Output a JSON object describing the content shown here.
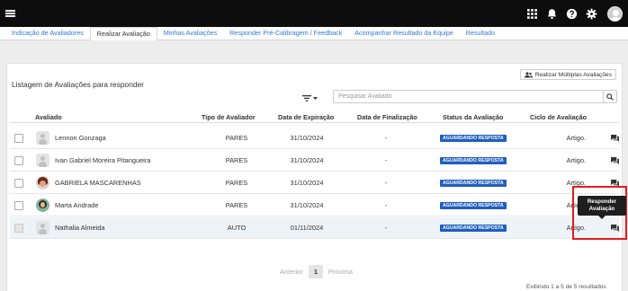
{
  "tabs": [
    {
      "label": "Indicação de Avaliadores"
    },
    {
      "label": "Realizar Avaliação"
    },
    {
      "label": "Minhas Avaliações"
    },
    {
      "label": "Responder Pré-Calibragem / Feedback"
    },
    {
      "label": "Acompanhar Resultado da Equipe"
    },
    {
      "label": "Resultado"
    }
  ],
  "panel": {
    "title": "Listagem de Avaliações para responder",
    "multi_button": "Realizar Múltiplas Avaliações",
    "search_placeholder": "Pesquisar Avaliado"
  },
  "columns": {
    "avaliado": "Avaliado",
    "tipo": "Tipo de Avaliador",
    "expiracao": "Data de Expiração",
    "finalizacao": "Data de Finalização",
    "status": "Status da Avaliação",
    "ciclo": "Ciclo de Avaliação"
  },
  "rows": [
    {
      "name": "Lennon Gonzaga",
      "tipo": "PARES",
      "expiracao": "31/10/2024",
      "finalizacao": "-",
      "status": "AGUARDANDO RESPOSTA",
      "ciclo": "Artigo."
    },
    {
      "name": "Ivan Gabriel Moreira Pitangueira",
      "tipo": "PARES",
      "expiracao": "31/10/2024",
      "finalizacao": "-",
      "status": "AGUARDANDO RESPOSTA",
      "ciclo": "Artigo."
    },
    {
      "name": "GABRIELA MASCARENHAS",
      "tipo": "PARES",
      "expiracao": "31/10/2024",
      "finalizacao": "-",
      "status": "AGUARDANDO RESPOSTA",
      "ciclo": "Artigo."
    },
    {
      "name": "Marta Andrade",
      "tipo": "PARES",
      "expiracao": "31/10/2024",
      "finalizacao": "-",
      "status": "AGUARDANDO RESPOSTA",
      "ciclo": "Artigo."
    },
    {
      "name": "Nathalia Almeida",
      "tipo": "AUTO",
      "expiracao": "01/11/2024",
      "finalizacao": "-",
      "status": "AGUARDANDO RESPOSTA",
      "ciclo": "Artigo."
    }
  ],
  "tooltip": {
    "line1": "Responder",
    "line2": "Avaliação"
  },
  "pagination": {
    "prev": "Anterior",
    "current": "1",
    "next": "Próxima"
  },
  "footer": "Exibindo 1 a 5 de 5 resultados",
  "colors": {
    "topbar": "#0d0d0d",
    "link": "#2e7bd6",
    "badge": "#1f5fbf",
    "highlight": "#e21d1d"
  }
}
